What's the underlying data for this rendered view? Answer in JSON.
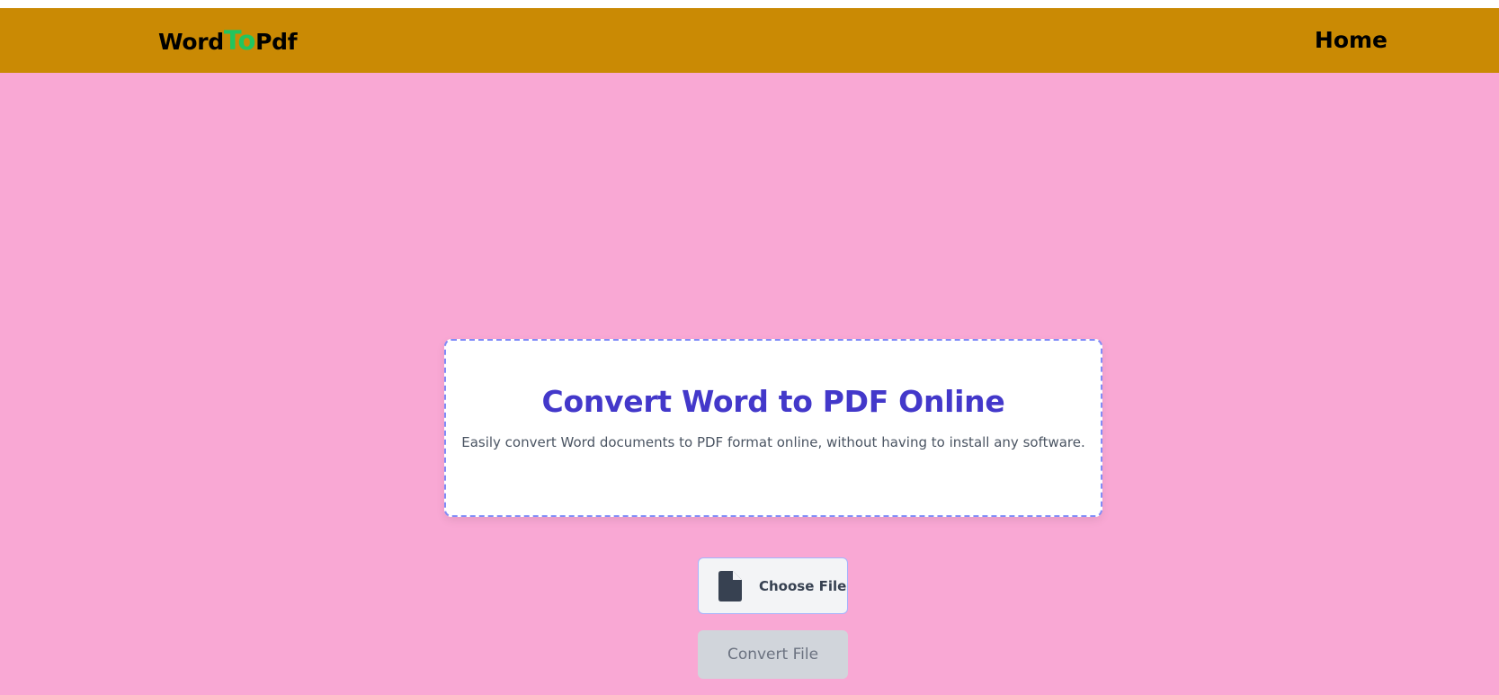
{
  "header": {
    "logo": {
      "part1": "Word",
      "part2": "To",
      "part3": "Pdf"
    },
    "nav_home": "Home"
  },
  "hero": {
    "title": "Convert Word to PDF Online",
    "subtitle": "Easily convert Word documents to PDF format online, without having to install any software."
  },
  "upload": {
    "choose_label": "Choose File",
    "choose_icon": "file-icon",
    "convert_label": "Convert File",
    "convert_enabled": false
  },
  "colors": {
    "background": "#f9a8d4",
    "navbar": "#ca8a04",
    "logo_accent": "#22c55e",
    "title": "#4338ca",
    "card_border": "#818cf8"
  }
}
